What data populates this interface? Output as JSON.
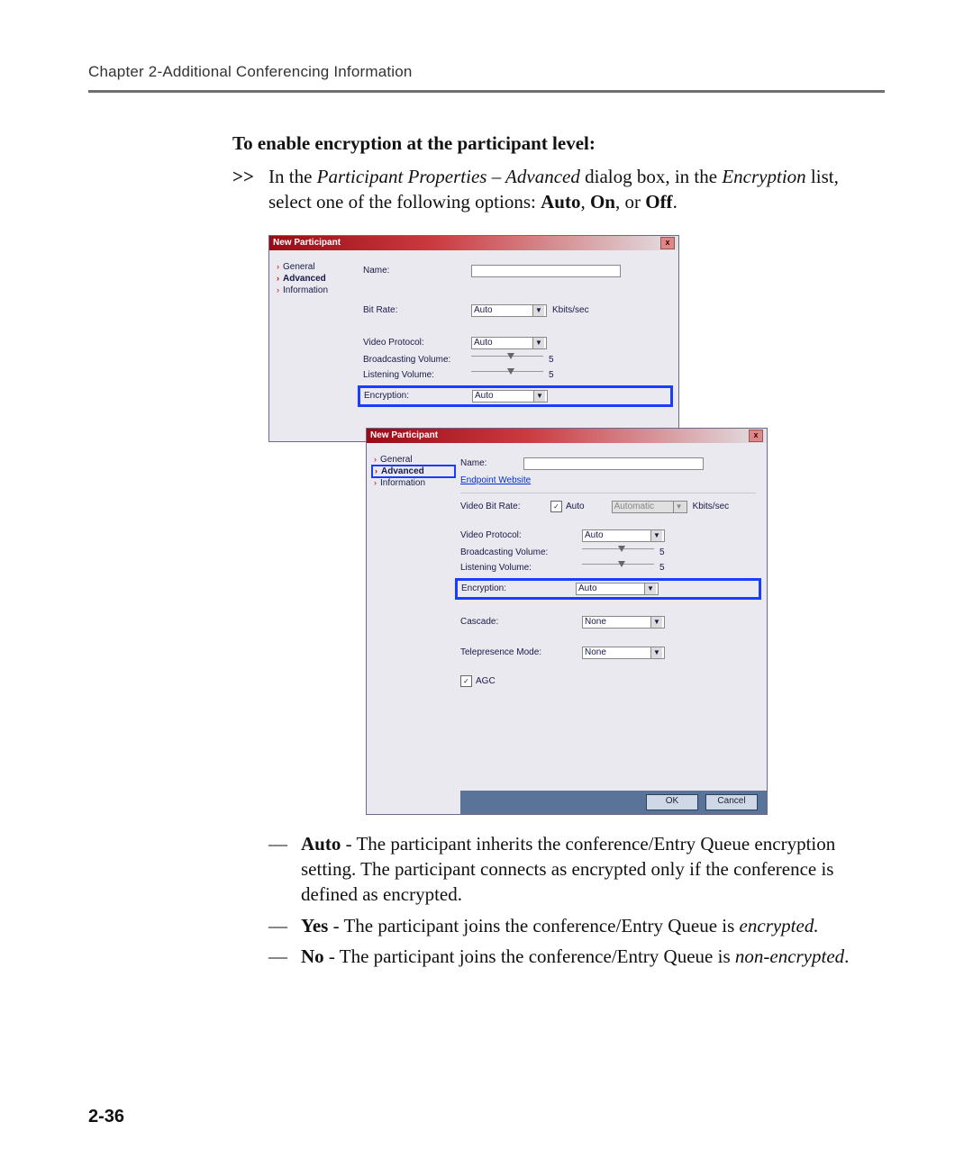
{
  "header": {
    "running": "Chapter 2-Additional Conferencing Information"
  },
  "heading": "To enable encryption at the participant level:",
  "step": {
    "marker": ">>",
    "pre": "In the ",
    "ital": "Participant Properties – Advanced",
    "mid": " dialog box, in the ",
    "ital2": "Encryption",
    "post": " list, select one of the following options: ",
    "b1": "Auto",
    "c1": ", ",
    "b2": "On",
    "c2": ", or ",
    "b3": "Off",
    "end": "."
  },
  "dlgBack": {
    "title": "New Participant",
    "side": {
      "general": "General",
      "advanced": "Advanced",
      "information": "Information"
    },
    "name_lbl": "Name:",
    "bitrate_lbl": "Bit Rate:",
    "bitrate_val": "Auto",
    "bitrate_unit": "Kbits/sec",
    "vproto_lbl": "Video Protocol:",
    "vproto_val": "Auto",
    "bvol_lbl": "Broadcasting Volume:",
    "lvol_lbl": "Listening Volume:",
    "vol_val": "5",
    "enc_lbl": "Encryption:",
    "enc_val": "Auto"
  },
  "dlgFront": {
    "title": "New Participant",
    "side": {
      "general": "General",
      "advanced": "Advanced",
      "information": "Information"
    },
    "name_lbl": "Name:",
    "endpoint": "Endpoint Website",
    "vbr_lbl": "Video Bit Rate:",
    "vbr_auto": "Auto",
    "vbr_val": "Automatic",
    "vbr_unit": "Kbits/sec",
    "vproto_lbl": "Video Protocol:",
    "vproto_val": "Auto",
    "bvol_lbl": "Broadcasting Volume:",
    "lvol_lbl": "Listening Volume:",
    "vol_val": "5",
    "enc_lbl": "Encryption:",
    "enc_val": "Auto",
    "cascade_lbl": "Cascade:",
    "cascade_val": "None",
    "tp_lbl": "Telepresence Mode:",
    "tp_val": "None",
    "agc": "AGC",
    "ok": "OK",
    "cancel": "Cancel"
  },
  "bullets": {
    "auto": {
      "b": "Auto",
      "t": " - The participant inherits the conference/Entry Queue encryption setting. The participant connects as encrypted only if the conference is defined as encrypted."
    },
    "yes": {
      "b": "Yes",
      "t1": " - The participant joins the conference/Entry Queue is ",
      "i": "encrypted."
    },
    "no": {
      "b": "No",
      "t1": " - The participant joins the conference/Entry Queue is ",
      "i": "non-encrypted",
      "t2": "."
    }
  },
  "dash": "—",
  "check": "✓",
  "close": "x",
  "dd": "▼",
  "chev": "›",
  "pagenum": "2-36"
}
